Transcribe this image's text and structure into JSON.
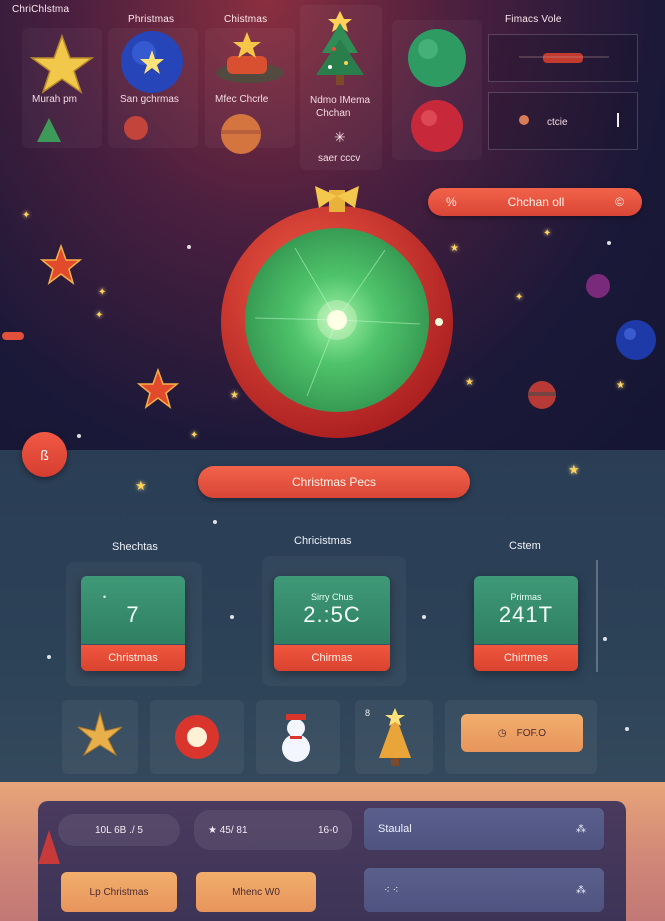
{
  "header": {
    "left_label": "ChriChlstma",
    "tab1": "Phristmas",
    "tab2": "Chistmas",
    "right_label": "Fimacs Vole"
  },
  "top_tiles": {
    "tile1_label": "Murah pm",
    "tile2_label": "San gchrmas",
    "tile3_label": "Mfec Chcrle",
    "tile4_label": "Ndmo IMema",
    "tile4_sub": "Chchan",
    "tile5_label": "saer cccv",
    "right_panel_value": "ctcie"
  },
  "top_button": {
    "label": "Chchan oll",
    "left_glyph": "%",
    "right_glyph": "©"
  },
  "left_circle_button": {
    "glyph": "ß"
  },
  "main_button": {
    "label": "Christmas Pecs"
  },
  "sections": {
    "left_title": "Shechtas",
    "center_title": "Chricistmas",
    "right_title": "Cstem"
  },
  "cards": [
    {
      "small": "•",
      "value": "7",
      "label": "Christmas"
    },
    {
      "small": "Sirry Chus",
      "value": "2.:5C",
      "label": "Chirmas"
    },
    {
      "small": "Prirmas",
      "value": "241T",
      "label": "Chirtmes"
    }
  ],
  "slots": {
    "slot3_label": "8",
    "slot5_button": "FOF.O"
  },
  "bottom": {
    "pill1": "10L 6B ./ 5",
    "pill2": "★ 45/ 81",
    "pill2_extra": "16-0",
    "btn1": "Lp  Christmas",
    "btn2": "Mhenc W0",
    "field1": "Staulal",
    "field1_icon": "⁂",
    "field2_icon": "⁂"
  },
  "colors": {
    "accent_red": "#e24a38",
    "accent_green": "#3f9a78",
    "accent_orange": "#eea26a"
  }
}
